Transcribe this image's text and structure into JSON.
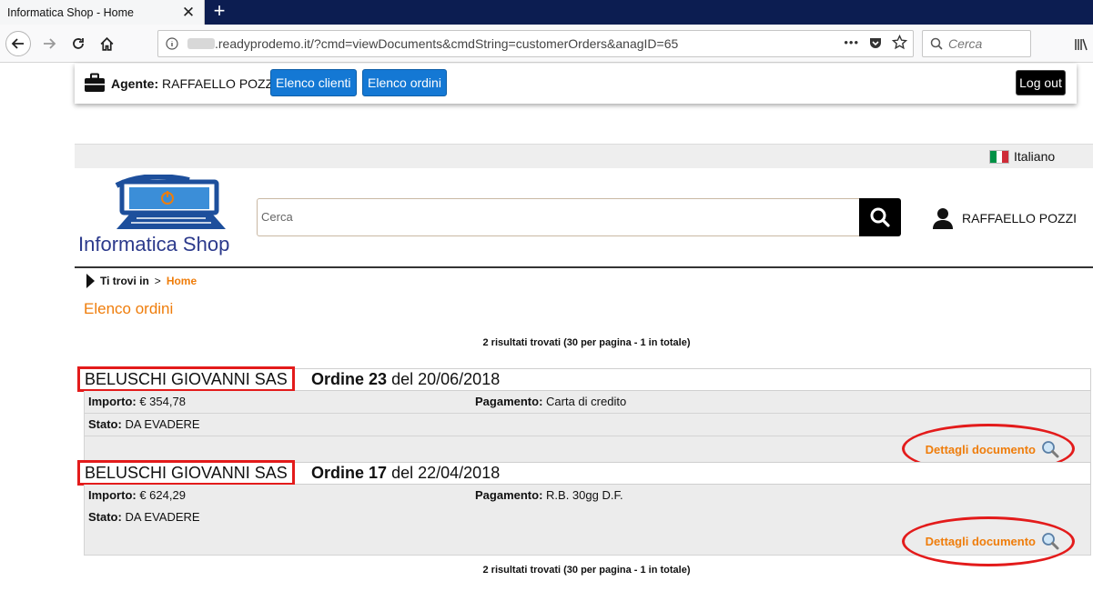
{
  "browser": {
    "tab_title": "Informatica Shop - Home",
    "tab_close": "✕",
    "new_tab": "+",
    "url": ".readyprodemo.it/?cmd=viewDocuments&cmdString=customerOrders&anagID=65",
    "menu_dots": "•••",
    "search_placeholder": "Cerca"
  },
  "agentbar": {
    "agent_label": "Agente:",
    "agent_name": "RAFFAELLO POZZI",
    "clients_button": "Elenco clienti",
    "orders_button": "Elenco ordini",
    "logout_button": "Log out"
  },
  "header": {
    "language": "Italiano",
    "logo_text": "Informatica Shop",
    "search_placeholder": "Cerca",
    "user_name": "RAFFAELLO POZZI"
  },
  "breadcrumb": {
    "label": "Ti trovi in",
    "separator": ">",
    "home": "Home"
  },
  "page_title": "Elenco ordini",
  "results_summary": "2 risultati trovati (30 per pagina - 1 in totale)",
  "labels": {
    "order": "Ordine",
    "of": "del",
    "amount": "Importo:",
    "payment": "Pagamento:",
    "status": "Stato:",
    "details": "Dettagli documento"
  },
  "orders": [
    {
      "customer": "BELUSCHI GIOVANNI SAS",
      "number": "23",
      "date": "20/06/2018",
      "amount": "€ 354,78",
      "payment": "Carta di credito",
      "status": "DA EVADERE"
    },
    {
      "customer": "BELUSCHI GIOVANNI SAS",
      "number": "17",
      "date": "22/04/2018",
      "amount": "€ 624,29",
      "payment": "R.B. 30gg D.F.",
      "status": "DA EVADERE"
    }
  ],
  "colors": {
    "accent_orange": "#ef7d0b",
    "primary_blue": "#1478d4",
    "highlight_red": "#e31b1b",
    "logo_blue": "#2c3a8c"
  }
}
